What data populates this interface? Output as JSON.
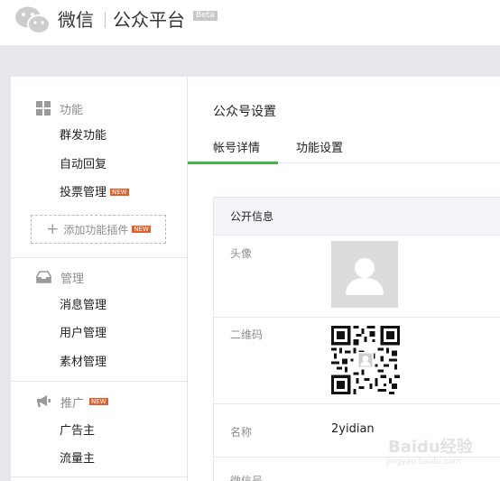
{
  "header": {
    "brand": "微信",
    "subtitle": "公众平台",
    "badge": "Beta"
  },
  "sidebar": {
    "sections": [
      {
        "title": "功能",
        "icon": "grid-icon",
        "items": [
          {
            "label": "群发功能"
          },
          {
            "label": "自动回复"
          },
          {
            "label": "投票管理",
            "badge": "NEW"
          }
        ],
        "add_plugin": {
          "label": "添加功能插件",
          "badge": "NEW"
        }
      },
      {
        "title": "管理",
        "icon": "inbox-icon",
        "items": [
          {
            "label": "消息管理"
          },
          {
            "label": "用户管理"
          },
          {
            "label": "素材管理"
          }
        ]
      },
      {
        "title": "推广",
        "icon": "megaphone-icon",
        "badge": "NEW",
        "items": [
          {
            "label": "广告主"
          },
          {
            "label": "流量主"
          }
        ]
      }
    ]
  },
  "main": {
    "title": "公众号设置",
    "tabs": [
      {
        "label": "帐号详情",
        "active": true
      },
      {
        "label": "功能设置",
        "active": false
      }
    ],
    "panel": {
      "heading": "公开信息",
      "rows": [
        {
          "label": "头像"
        },
        {
          "label": "二维码"
        },
        {
          "label": "名称",
          "value": "2yidian"
        },
        {
          "label": "微信号"
        }
      ]
    }
  },
  "watermark": {
    "text": "Baidu经验",
    "sub": "jingyan.baidu.com"
  },
  "colors": {
    "accent": "#44b549",
    "new_badge": "#e15f2d",
    "background": "#e7e8eb"
  }
}
